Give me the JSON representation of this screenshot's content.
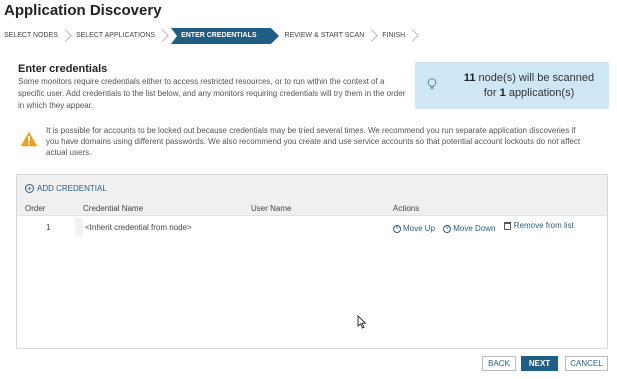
{
  "page": {
    "title": "Application Discovery"
  },
  "wizard": {
    "steps": [
      {
        "label": "SELECT NODES"
      },
      {
        "label": "SELECT APPLICATIONS"
      },
      {
        "label": "ENTER CREDENTIALS",
        "active": true
      },
      {
        "label": "REVIEW & START SCAN"
      },
      {
        "label": "FINISH"
      }
    ]
  },
  "main": {
    "heading": "Enter credentials",
    "intro": "Some monitors require credentials either to access restricted resources, or to run within the context of a specific user. Add credentials to the list below, and any monitors requiring credentials will try them in the order in which they appear."
  },
  "info": {
    "icon": "lightbulb-icon",
    "node_count": "11",
    "line1_suffix": " node(s) will be scanned",
    "line2_prefix": "for ",
    "app_count": "1",
    "line2_suffix": " application(s)"
  },
  "warning": {
    "icon": "warning-icon",
    "color": "#f0a020",
    "text": "It is possible for accounts to be locked out because credentials may be tried several times. We recommend you run separate application discoveries if you have domains using different passwords. We also recommend you create and use service accounts so that potential account lockouts do not affect actual users."
  },
  "grid": {
    "add_label": "ADD CREDENTIAL",
    "columns": {
      "order": "Order",
      "name": "Credential Name",
      "user": "User Name",
      "actions": "Actions"
    },
    "rows": [
      {
        "order": "1",
        "name": "<Inherit credential from node>",
        "user": ""
      }
    ],
    "actions": {
      "move_up": "Move Up",
      "move_down": "Move Down",
      "remove": "Remove from list"
    }
  },
  "footer": {
    "back": "BACK",
    "next": "NEXT",
    "cancel": "CANCEL"
  },
  "colors": {
    "accent": "#1f5f86",
    "info_bg": "#cfe6f5",
    "link": "#2a5f86"
  }
}
